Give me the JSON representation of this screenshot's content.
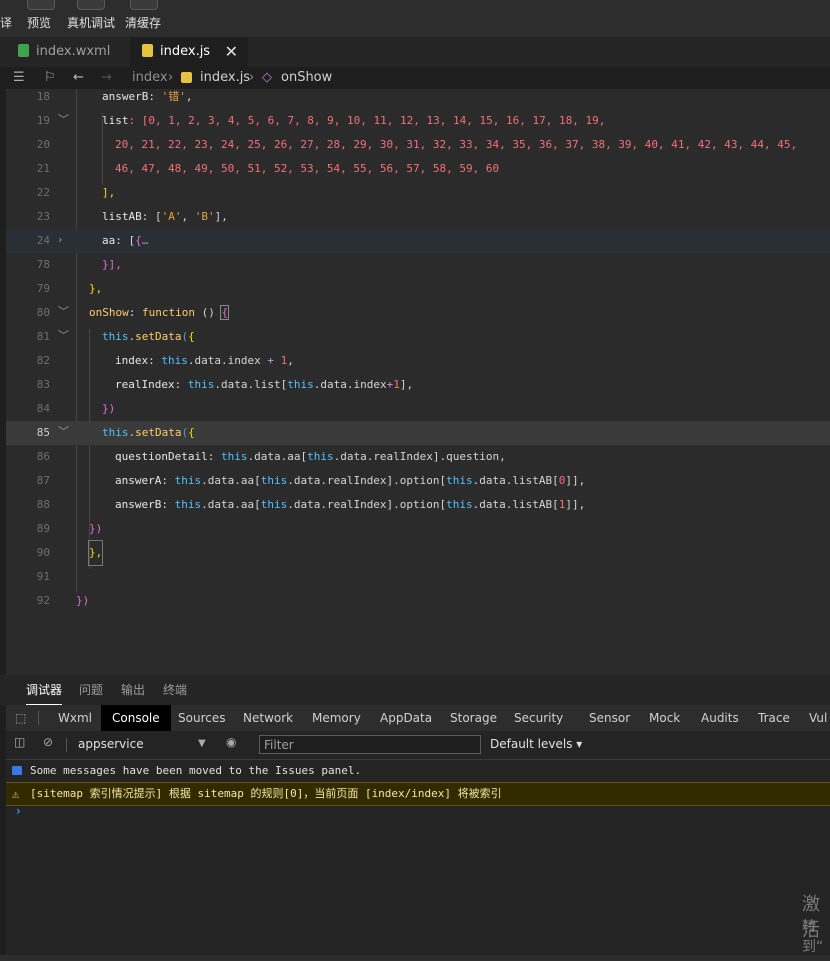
{
  "toolbar": {
    "compile": "译",
    "preview": "预览",
    "remote_debug": "真机调试",
    "clear_cache": "清缓存"
  },
  "tabs": [
    {
      "label": "index.wxml",
      "active": false
    },
    {
      "label": "index.js",
      "active": true,
      "close": "✕"
    }
  ],
  "breadcrumb": {
    "folder": "index",
    "file": "index.js",
    "symbol": "onShow",
    "sep": "›"
  },
  "code": {
    "l18": {
      "num": "18",
      "prop": "answerB",
      "rest": ": ",
      "str": "'错'",
      "end": ","
    },
    "l19": {
      "num": "19",
      "prop": "list",
      "text": ": [0, 1, 2, 3, 4, 5, 6, 7, 8, 9, 10, 11, 12, 13, 14, 15, 16, 17, 18, 19,"
    },
    "l20": {
      "num": "20",
      "text": "20, 21, 22, 23, 24, 25, 26, 27, 28, 29, 30, 31, 32, 33, 34, 35, 36, 37, 38, 39, 40, 41, 42, 43, 44, 45,"
    },
    "l21": {
      "num": "21",
      "text": "46, 47, 48, 49, 50, 51, 52, 53, 54, 55, 56, 57, 58, 59, 60"
    },
    "l22": {
      "num": "22",
      "text": "],"
    },
    "l23": {
      "num": "23",
      "prop": "listAB",
      "rest": ": [",
      "s1": "'A'",
      "comma": ", ",
      "s2": "'B'",
      "end": "],"
    },
    "l24": {
      "num": "24",
      "prop": "aa",
      "rest": ": [",
      "brace": "{",
      "ellipsis": "…"
    },
    "l78": {
      "num": "78",
      "text": "}],"
    },
    "l79": {
      "num": "79",
      "text": "},"
    },
    "l80": {
      "num": "80",
      "fn": "onShow",
      "colon": ": ",
      "kw": "function",
      "rest": " () ",
      "brace": "{"
    },
    "l81": {
      "num": "81",
      "kw": "this",
      "dot": ".",
      "fn": "setData",
      "paren": "(",
      "brace": "{"
    },
    "l82": {
      "num": "82",
      "prop": "index",
      "colon": ": ",
      "kw": "this",
      "mid": ".data.index ",
      "op": "+",
      "num1": " 1",
      "end": ","
    },
    "l83": {
      "num": "83",
      "prop": "realIndex",
      "colon": ": ",
      "kw": "this",
      "mid": ".data.list[",
      "kw2": "this",
      "mid2": ".data.index",
      "op": "+",
      "n": "1",
      "end": "],"
    },
    "l84": {
      "num": "84",
      "text": "})"
    },
    "l85": {
      "num": "85",
      "kw": "this",
      "dot": ".",
      "fn": "setData",
      "paren": "(",
      "brace": "{"
    },
    "l86": {
      "num": "86",
      "prop": "questionDetail",
      "colon": ": ",
      "kw": "this",
      "mid": ".data.aa[",
      "kw2": "this",
      "mid2": ".data.realIndex].question,"
    },
    "l87": {
      "num": "87",
      "prop": "answerA",
      "colon": ": ",
      "kw": "this",
      "mid": ".data.aa[",
      "kw2": "this",
      "mid2": ".data.realIndex].option[",
      "kw3": "this",
      "mid3": ".data.listAB[",
      "n": "0",
      "end": "]],"
    },
    "l88": {
      "num": "88",
      "prop": "answerB",
      "colon": ": ",
      "kw": "this",
      "mid": ".data.aa[",
      "kw2": "this",
      "mid2": ".data.realIndex].option[",
      "kw3": "this",
      "mid3": ".data.listAB[",
      "n": "1",
      "end": "]],"
    },
    "l89": {
      "num": "89",
      "text": "})"
    },
    "l90": {
      "num": "90",
      "text": "},"
    },
    "l91": {
      "num": "91",
      "text": ""
    },
    "l92": {
      "num": "92",
      "text": "})"
    }
  },
  "panel_tabs": [
    "调试器",
    "问题",
    "输出",
    "终端"
  ],
  "devtools_tabs": [
    "Wxml",
    "Console",
    "Sources",
    "Network",
    "Memory",
    "AppData",
    "Storage",
    "Security",
    "Sensor",
    "Mock",
    "Audits",
    "Trace",
    "Vul"
  ],
  "console_toolbar": {
    "context": "appservice",
    "filter_placeholder": "Filter",
    "levels": "Default levels ▾"
  },
  "console": {
    "info": "Some messages have been moved to the Issues panel.",
    "warn": "[sitemap 索引情况提示] 根据 sitemap 的规则[0]，当前页面 [index/index] 将被索引",
    "prompt": "›"
  },
  "watermark": {
    "line1": "激活",
    "line2": "转到“"
  },
  "colors": {
    "accent": "#4fa3ff",
    "warn_bg": "#332b00",
    "editor_bg": "#2b2b2b"
  }
}
